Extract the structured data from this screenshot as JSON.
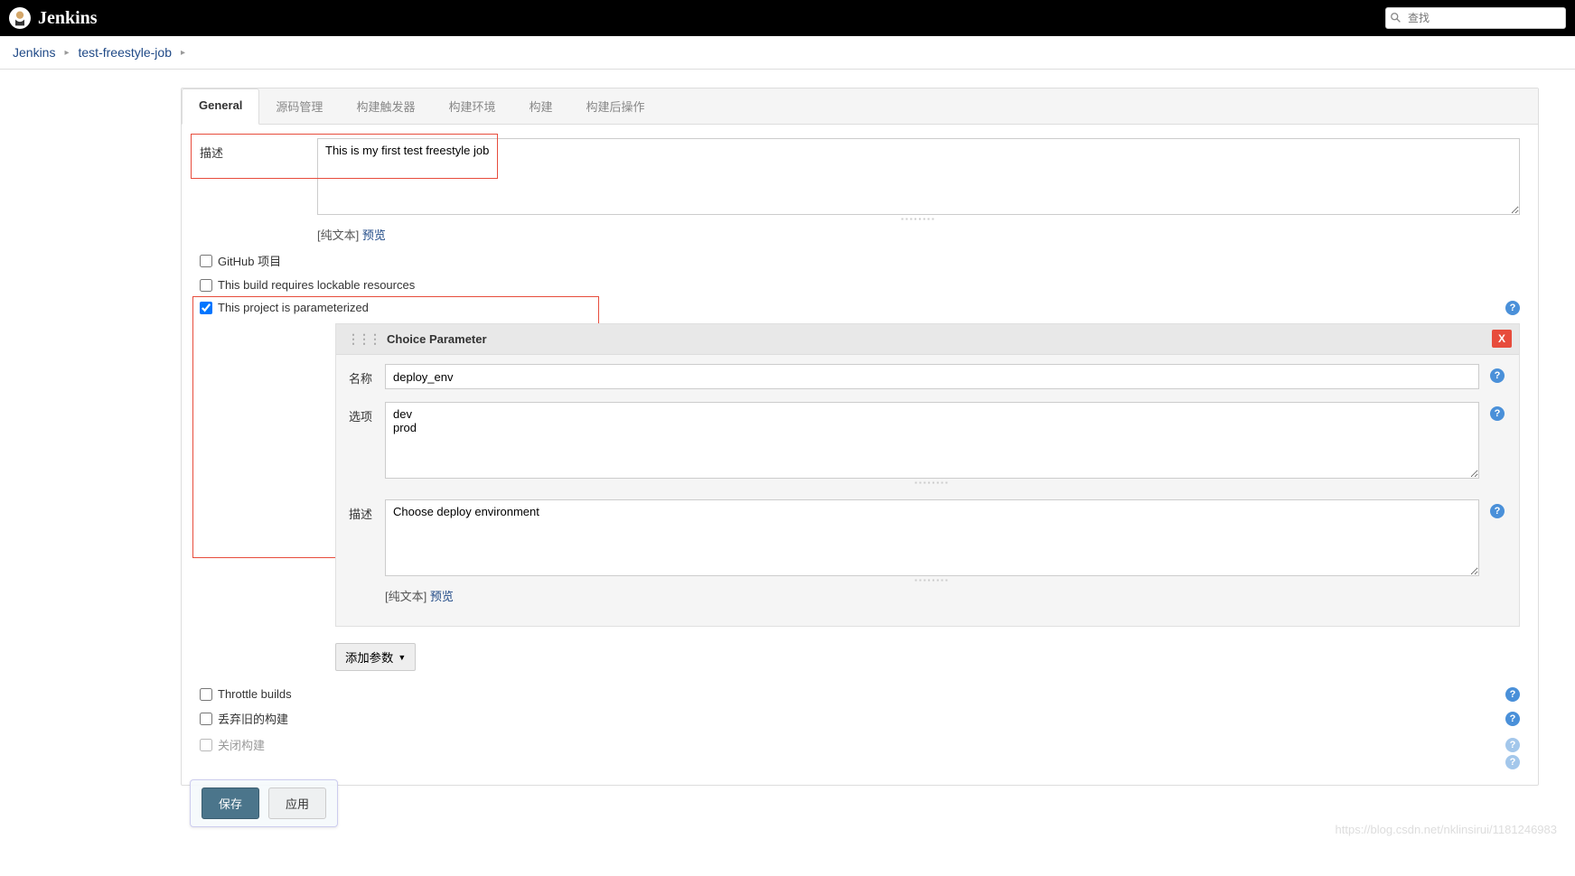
{
  "header": {
    "logo_text": "Jenkins",
    "search_placeholder": "查找"
  },
  "breadcrumb": {
    "items": [
      "Jenkins",
      "test-freestyle-job"
    ]
  },
  "tabs": {
    "items": [
      "General",
      "源码管理",
      "构建触发器",
      "构建环境",
      "构建",
      "构建后操作"
    ],
    "active": 0
  },
  "general": {
    "description_label": "描述",
    "description_value": "This is my first test freestyle job",
    "plain_text_label": "[纯文本]",
    "preview_label": "预览"
  },
  "checkboxes": {
    "github_project": "GitHub 项目",
    "lockable": "This build requires lockable resources",
    "parameterized": "This project is parameterized",
    "throttle": "Throttle builds",
    "discard_old": "丢弃旧的构建",
    "disable_build": "关闭构建"
  },
  "parameter": {
    "title": "Choice Parameter",
    "name_label": "名称",
    "name_value": "deploy_env",
    "options_label": "选项",
    "options_value": "dev\nprod",
    "desc_label": "描述",
    "desc_value": "Choose deploy environment",
    "plain_text_label": "[纯文本]",
    "preview_label": "预览",
    "add_button": "添加参数",
    "delete_label": "X"
  },
  "footer": {
    "save": "保存",
    "apply": "应用"
  },
  "watermark": "https://blog.csdn.net/nklinsirui/1181246983"
}
